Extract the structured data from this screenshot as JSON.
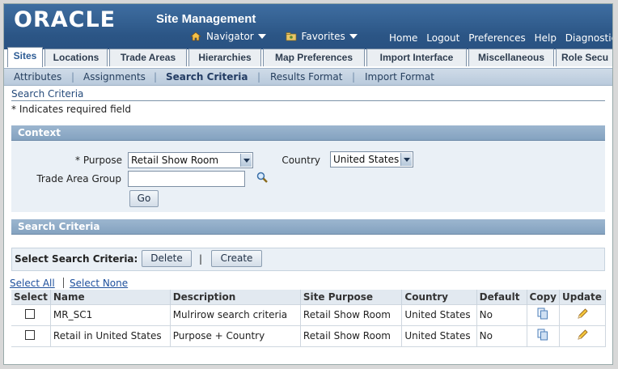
{
  "brand": {
    "logo": "ORACLE",
    "app_title": "Site Management"
  },
  "nav": {
    "navigator": "Navigator",
    "favorites": "Favorites",
    "global_links": [
      "Home",
      "Logout",
      "Preferences",
      "Help",
      "Diagnostics"
    ]
  },
  "tabs": [
    "Sites",
    "Locations",
    "Trade Areas",
    "Hierarchies",
    "Map Preferences",
    "Import Interface",
    "Miscellaneous",
    "Role Secu"
  ],
  "subnav": [
    "Attributes",
    "Assignments",
    "Search Criteria",
    "Results Format",
    "Import Format"
  ],
  "page": {
    "title": "Search Criteria",
    "required_note": "* Indicates required field"
  },
  "context": {
    "header": "Context",
    "purpose_label": "* Purpose",
    "purpose_value": "Retail Show Room",
    "country_label": "Country",
    "country_value": "United States",
    "trade_area_group_label": "Trade Area Group",
    "trade_area_group_value": "",
    "go_button": "Go"
  },
  "search": {
    "header": "Search Criteria",
    "select_label": "Select Search Criteria:",
    "delete_button": "Delete",
    "separator": "|",
    "create_button": "Create",
    "select_all": "Select All",
    "select_none": "Select None",
    "columns": [
      "Select",
      "Name",
      "Description",
      "Site Purpose",
      "Country",
      "Default",
      "Copy",
      "Update"
    ],
    "rows": [
      {
        "name": "MR_SC1",
        "description": "Mulrirow search criteria",
        "site_purpose": "Retail Show Room",
        "country": "United States",
        "default": "No"
      },
      {
        "name": "Retail in United States",
        "description": "Purpose + Country",
        "site_purpose": "Retail Show Room",
        "country": "United States",
        "default": "No"
      }
    ]
  },
  "colors": {
    "brand_bar": "#2b5585",
    "section_header": "#8ba8c5",
    "link": "#1d4f9c"
  }
}
